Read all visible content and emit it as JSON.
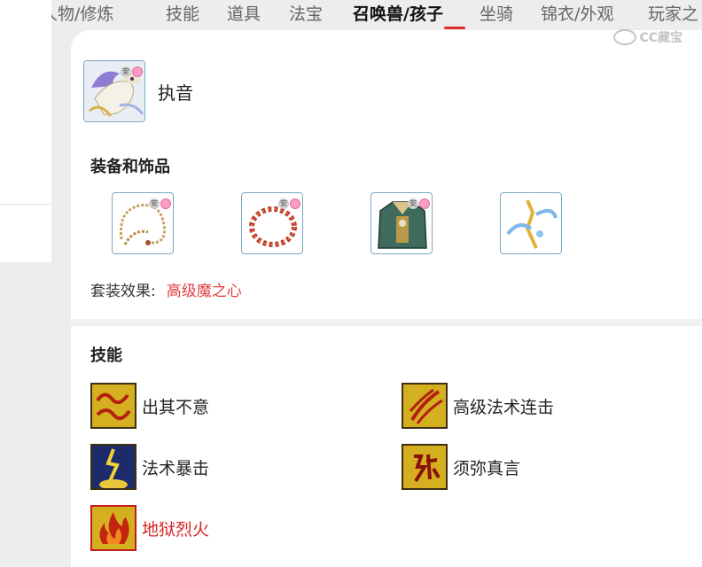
{
  "tabs": [
    {
      "label": "人物/修炼",
      "active": false
    },
    {
      "label": "技能",
      "active": false
    },
    {
      "label": "道具",
      "active": false
    },
    {
      "label": "法宝",
      "active": false
    },
    {
      "label": "召唤兽/孩子",
      "active": true
    },
    {
      "label": "坐骑",
      "active": false
    },
    {
      "label": "锦衣/外观",
      "active": false
    },
    {
      "label": "玩家之",
      "active": false
    }
  ],
  "watermark": {
    "text": "CC藏宝"
  },
  "pet": {
    "name": "执音",
    "icon": "phoenix-pet-icon"
  },
  "equipment": {
    "title": "装备和饰品",
    "items": [
      {
        "icon": "bead-necklace-icon"
      },
      {
        "icon": "red-bead-collar-icon"
      },
      {
        "icon": "armor-icon"
      },
      {
        "icon": "blue-charm-accessory-icon"
      }
    ],
    "set_label": "套装效果:",
    "set_value": "高级魔之心"
  },
  "skills": {
    "title": "技能",
    "items": [
      {
        "label": "出其不意",
        "icon": "surprise-strike-icon",
        "special": false
      },
      {
        "label": "高级法术连击",
        "icon": "spell-combo-icon",
        "special": false
      },
      {
        "label": "法术暴击",
        "icon": "spell-crit-icon",
        "special": false
      },
      {
        "label": "须弥真言",
        "icon": "sumeru-mantra-icon",
        "special": false
      },
      {
        "label": "地狱烈火",
        "icon": "hellfire-icon",
        "special": true
      }
    ]
  },
  "colors": {
    "accent_red": "#e02a2a",
    "set_value_red": "#e04040",
    "skill_gold": "#d4b020"
  }
}
